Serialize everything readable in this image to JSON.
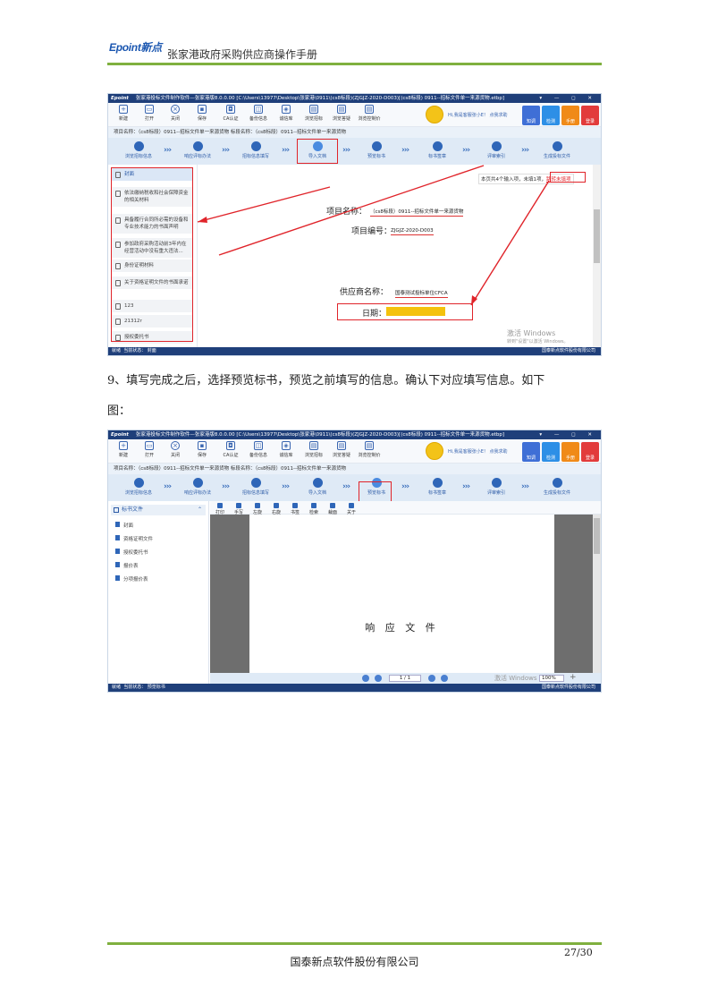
{
  "header": {
    "logo_latin": "Epoint",
    "logo_cn": "新点",
    "title": "张家港政府采购供应商操作手册"
  },
  "app": {
    "brand": "Epoint",
    "window_title": "张家港投标文件制作软件—张家港版8.0.0.00  [C:\\Users\\13977\\Desktop\\张家港\\0911\\(cs8标段)(ZJGJZ-2020-D003)[(cs8标段) 0911--招标文件单一来源货物.etbp]",
    "window_controls": "▾ — ◻ ✕",
    "toolbar": [
      "新建",
      "打开",
      "关闭",
      "保存",
      "CA认证",
      "备份信息",
      "诚信库",
      "浏览招标",
      "浏览答疑",
      "浏览控制价"
    ],
    "greeting": "Hi,我是客服张小E！ 点我求助",
    "side_buttons": [
      {
        "label": "知调",
        "color": "#3f6fd6"
      },
      {
        "label": "检测",
        "color": "#2d8fe6"
      },
      {
        "label": "手册",
        "color": "#f08a18"
      },
      {
        "label": "登录",
        "color": "#e23b3b"
      }
    ],
    "infobar": "项目名称：（cs8标段）0911--招标文件单一来源货物    标段名称：（cs8标段）0911--招标文件单一来源货物",
    "steps": [
      "浏览招标信息",
      "响应评标办法",
      "招标信息填写",
      "导入文档",
      "预览标书",
      "标书签章",
      "评审索引",
      "生成投标文件"
    ],
    "status_left": "就绪",
    "status_right": "国泰新点软件股份有限公司"
  },
  "window1": {
    "current_node": "当前状态：  封面",
    "list_items": [
      "封面",
      "依法缴纳税收和社会保障资金的相关材料",
      "具备履行合同所必需的设备和专业技术能力的书面声明",
      "参加政府采购活动前3年内在经营活动中没有重大违法...",
      "身份证明材料",
      "关于资格证明文件的书面承诺",
      "123",
      "21312r",
      "授权委托书"
    ],
    "hint_text": "本页共4个输入项，未填1项，",
    "hint_link": "跳转未填项",
    "project_name_label": "项目名称：",
    "project_name_value": "（cs8标段）0911--招标文件单一来源货物",
    "project_code_label": "项目编号：",
    "project_code_value": "ZJGJZ-2020-D003",
    "supplier_label": "供应商名称：",
    "supplier_value": "国泰测试投标单位CFCA",
    "date_label": "日期：",
    "highlight_color": "#f4c20d",
    "watermark_title": "激活 Windows",
    "watermark_sub": "转到\"设置\"以激活 Windows。"
  },
  "paragraph": {
    "line1": "9、填写完成之后，选择预览标书，预览之前填写的信息。确认下对应填写信息。如下",
    "line2": "图："
  },
  "window2": {
    "current_node": "当前状态：  预览标书",
    "tree_title": "标书文件",
    "tree_items": [
      "封面",
      "资格证明文件",
      "授权委托书",
      "报价表",
      "分项报价表"
    ],
    "viewer_tools": [
      "打印",
      "手写",
      "左旋",
      "右旋",
      "书签",
      "检索",
      "裁面",
      "关于"
    ],
    "doc_title": "响 应 文 件",
    "page_indicator": "1 / 1",
    "zoom": "100%",
    "watermark": "激活 Windows"
  },
  "footer": {
    "page": "27/30",
    "company": "国泰新点软件股份有限公司"
  }
}
